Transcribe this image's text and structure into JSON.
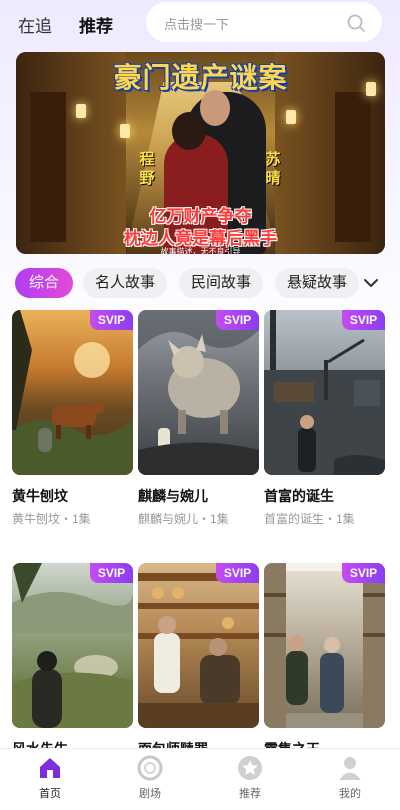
{
  "header": {
    "tabs": [
      {
        "label": "在追"
      },
      {
        "label": "推荐"
      }
    ],
    "search": {
      "placeholder": "点击搜一下"
    }
  },
  "banner": {
    "title": "豪门遗产谜案",
    "name_left": "程野",
    "name_right": "苏晴",
    "line1": "亿万财产争夺",
    "line2": "枕边人竟是幕后黑手",
    "disclaimer": "故事描述，无不良引导"
  },
  "categories": [
    {
      "label": "综合",
      "active": true
    },
    {
      "label": "名人故事",
      "active": false
    },
    {
      "label": "民间故事",
      "active": false
    },
    {
      "label": "悬疑故事",
      "active": false
    }
  ],
  "cards": [
    {
      "badge": "SVIP",
      "title": "黄牛刨坟",
      "subtitle": "黄牛刨坟・1集"
    },
    {
      "badge": "SVIP",
      "title": "麒麟与婉儿",
      "subtitle": "麒麟与婉儿・1集"
    },
    {
      "badge": "SVIP",
      "title": "首富的诞生",
      "subtitle": "首富的诞生・1集"
    },
    {
      "badge": "SVIP",
      "title": "风水先生",
      "subtitle": ""
    },
    {
      "badge": "SVIP",
      "title": "面包师赎罪",
      "subtitle": ""
    },
    {
      "badge": "SVIP",
      "title": "零售之王",
      "subtitle": ""
    }
  ],
  "bottom_nav": [
    {
      "label": "首页",
      "icon": "home-icon",
      "active": true
    },
    {
      "label": "剧场",
      "icon": "theater-icon",
      "active": false
    },
    {
      "label": "推荐",
      "icon": "star-icon",
      "active": false
    },
    {
      "label": "我的",
      "icon": "user-icon",
      "active": false
    }
  ],
  "colors": {
    "accent": "#b03ef0",
    "accent_end": "#e24ad8",
    "svip": "#c64cf0",
    "nav_active": "#7a2ee0"
  }
}
